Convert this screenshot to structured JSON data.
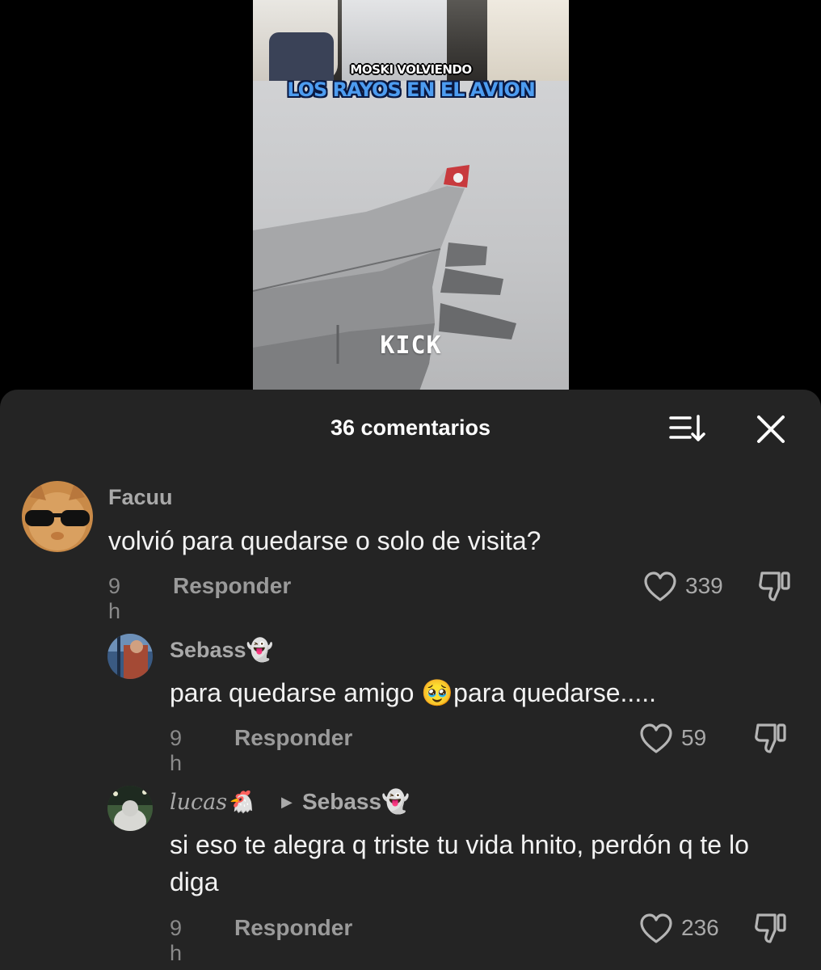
{
  "video": {
    "caption_line1": "MOSKI VOLVIENDO",
    "caption_line2": "LOS RAYOS EN EL AVION",
    "watermark": "KICK"
  },
  "comments_panel": {
    "title": "36 comentarios",
    "sort_icon": "sort-icon",
    "close_icon": "close-icon"
  },
  "comments": [
    {
      "username": "Facuu",
      "text": "volvió para quedarse o solo de visita?",
      "time": "9 h",
      "reply_label": "Responder",
      "likes": "339"
    },
    {
      "username": "Sebass👻",
      "text": "para quedarse amigo 🥹para quedarse.....",
      "time": "9 h",
      "reply_label": "Responder",
      "likes": "59"
    },
    {
      "username": "lucas🐔",
      "reply_to": "Sebass👻",
      "text": "si eso te alegra q triste tu vida hnito, perdón q te lo diga",
      "time": "9 h",
      "reply_label": "Responder",
      "likes": "236"
    }
  ]
}
